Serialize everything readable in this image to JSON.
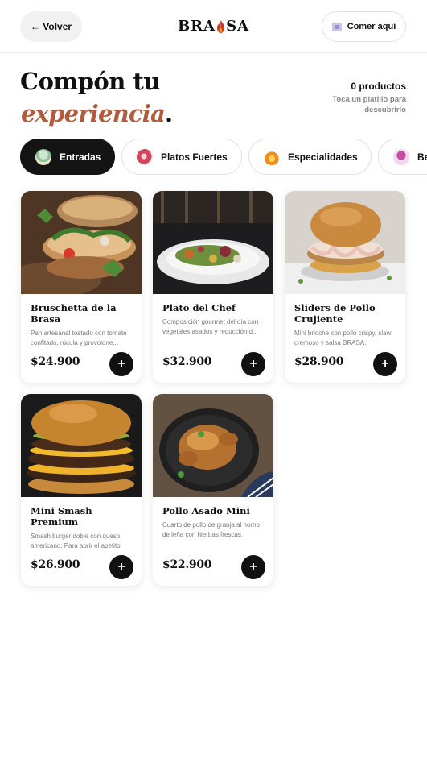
{
  "header": {
    "back_label": "← Volver",
    "logo_left": "BRA",
    "logo_right": "SA",
    "dine_label": "Comer aquí",
    "logo_flame_color": "#c0392b"
  },
  "hero": {
    "title_line1": "Compón tu",
    "title_line2": "experiencia",
    "title_dot": ".",
    "accent_color": "#b25a3c",
    "products_count": "0 productos",
    "hint": "Toca un platillo para descubrirlo"
  },
  "tabs": [
    {
      "label": "Entradas",
      "icon": "salad-bowl-icon",
      "active": true
    },
    {
      "label": "Platos Fuertes",
      "icon": "steak-icon",
      "active": false
    },
    {
      "label": "Especialidades",
      "icon": "flame-icon",
      "active": false
    },
    {
      "label": "Be",
      "icon": "wine-glass-icon",
      "active": false
    }
  ],
  "products": [
    {
      "name": "Bruschetta de la Brasa",
      "description": "Pan artesanal tostado con tomate confitado, rúcula y provolone...",
      "price": "$24.900",
      "add_label": "+"
    },
    {
      "name": "Plato del Chef",
      "description": "Composición gourmet del día con vegetales asados y reducción d...",
      "price": "$32.900",
      "add_label": "+"
    },
    {
      "name": "Sliders de Pollo Crujiente",
      "description": "Mini brioche con pollo crispy, slaw cremoso y salsa BRASA.",
      "price": "$28.900",
      "add_label": "+"
    },
    {
      "name": "Mini Smash Premium",
      "description": "Smash burger doble con queso americano. Para abrir el apetito.",
      "price": "$26.900",
      "add_label": "+"
    },
    {
      "name": "Pollo Asado Mini",
      "description": "Cuarto de pollo de granja al horno de leña con hierbas frescas.",
      "price": "$22.900",
      "add_label": "+"
    }
  ]
}
